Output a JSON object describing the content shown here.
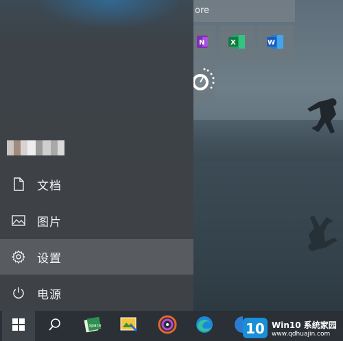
{
  "start_menu": {
    "search_tile_text": "ore",
    "items": [
      {
        "label": "文档",
        "icon": "document-icon"
      },
      {
        "label": "图片",
        "icon": "pictures-icon"
      },
      {
        "label": "设置",
        "icon": "gear-icon"
      },
      {
        "label": "电源",
        "icon": "power-icon"
      }
    ],
    "tiles": [
      {
        "icon": "onenote-icon",
        "letter": "N",
        "color": "#7f2eb3"
      },
      {
        "icon": "excel-icon",
        "letter": "X",
        "color": "#1d7044"
      },
      {
        "icon": "word-icon",
        "letter": "W",
        "color": "#2b5fb8"
      },
      {
        "icon": "stopwatch-icon"
      }
    ]
  },
  "taskbar": {
    "items": [
      {
        "name": "start-button",
        "icon": "windows-logo-icon"
      },
      {
        "name": "search-button",
        "icon": "search-icon"
      },
      {
        "name": "app-spacesuit",
        "icon": "spacesuit-app-icon"
      },
      {
        "name": "app-snipping",
        "icon": "image-edit-icon"
      },
      {
        "name": "app-music",
        "icon": "music-player-icon"
      },
      {
        "name": "app-edge",
        "icon": "edge-icon"
      }
    ]
  },
  "watermark": {
    "title": "Win10 系统家园",
    "url": "www.qdhuajin.com"
  }
}
